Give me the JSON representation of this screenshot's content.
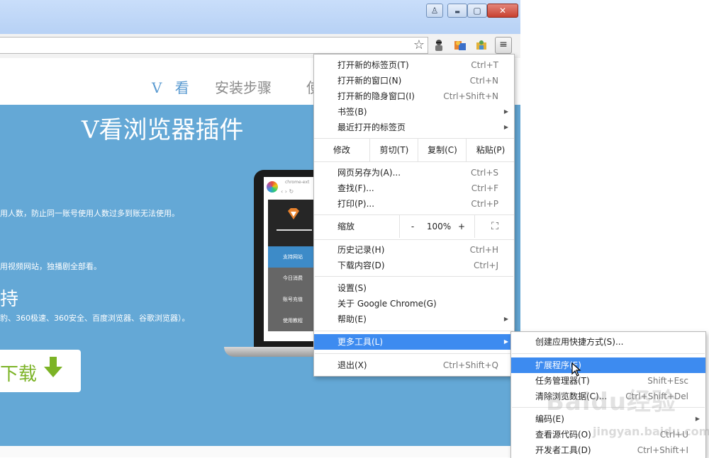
{
  "window": {
    "controls": {
      "user": "♙",
      "minimize": "▬",
      "maximize": "▢",
      "close": "✕"
    }
  },
  "toolbar": {
    "star_glyph": "☆",
    "menu_glyph": "≡"
  },
  "page": {
    "nav": [
      "V 看",
      "安装步骤",
      "使"
    ],
    "hero_title": "V看浏览器插件",
    "lines": [
      "用人数，防止同一账号使用人数过多到账无法使用。",
      "用视频网站，独播剧全部看。",
      "豹、360极速、360安全、百度浏览器、谷歌浏览器）。"
    ],
    "support_heading": "持",
    "download_label": "下载",
    "laptop_tab": "chrome-ext",
    "laptop_items": [
      "支持网站",
      "今日消费",
      "账号充值",
      "使用教程"
    ]
  },
  "menu": {
    "groups1": [
      {
        "label": "打开新的标签页(T)",
        "shortcut": "Ctrl+T"
      },
      {
        "label": "打开新的窗口(N)",
        "shortcut": "Ctrl+N"
      },
      {
        "label": "打开新的隐身窗口(I)",
        "shortcut": "Ctrl+Shift+N"
      },
      {
        "label": "书签(B)",
        "arrow": "▶"
      },
      {
        "label": "最近打开的标签页",
        "arrow": "▶"
      }
    ],
    "edit": {
      "label": "修改",
      "cut": "剪切(T)",
      "copy": "复制(C)",
      "paste": "粘贴(P)"
    },
    "groups2": [
      {
        "label": "网页另存为(A)...",
        "shortcut": "Ctrl+S"
      },
      {
        "label": "查找(F)...",
        "shortcut": "Ctrl+F"
      },
      {
        "label": "打印(P)...",
        "shortcut": "Ctrl+P"
      }
    ],
    "zoom": {
      "label": "缩放",
      "minus": "-",
      "value": "100%",
      "plus": "+",
      "fullscreen": "⛶"
    },
    "groups3": [
      {
        "label": "历史记录(H)",
        "shortcut": "Ctrl+H"
      },
      {
        "label": "下载内容(D)",
        "shortcut": "Ctrl+J"
      }
    ],
    "groups4": [
      {
        "label": "设置(S)"
      },
      {
        "label": "关于 Google Chrome(G)"
      },
      {
        "label": "帮助(E)",
        "arrow": "▶"
      }
    ],
    "more_tools": {
      "label": "更多工具(L)",
      "arrow": "▶"
    },
    "exit": {
      "label": "退出(X)",
      "shortcut": "Ctrl+Shift+Q"
    }
  },
  "submenu": {
    "items": [
      {
        "label": "创建应用快捷方式(S)..."
      },
      {
        "label": "扩展程序(E)"
      },
      {
        "label": "任务管理器(T)",
        "shortcut": "Shift+Esc"
      },
      {
        "label": "清除浏览数据(C)...",
        "shortcut": "Ctrl+Shift+Del"
      },
      {
        "label": "编码(E)",
        "arrow": "▶"
      },
      {
        "label": "查看源代码(O)",
        "shortcut": "Ctrl+U"
      },
      {
        "label": "开发者工具(D)",
        "shortcut": "Ctrl+Shift+I"
      }
    ]
  },
  "watermark": {
    "brand": "Baidu经验",
    "url": "jingyan.baidu.com"
  },
  "colors": {
    "highlight": "#3d8bf0",
    "hero": "#64a8d6",
    "download_green": "#7cb326"
  }
}
